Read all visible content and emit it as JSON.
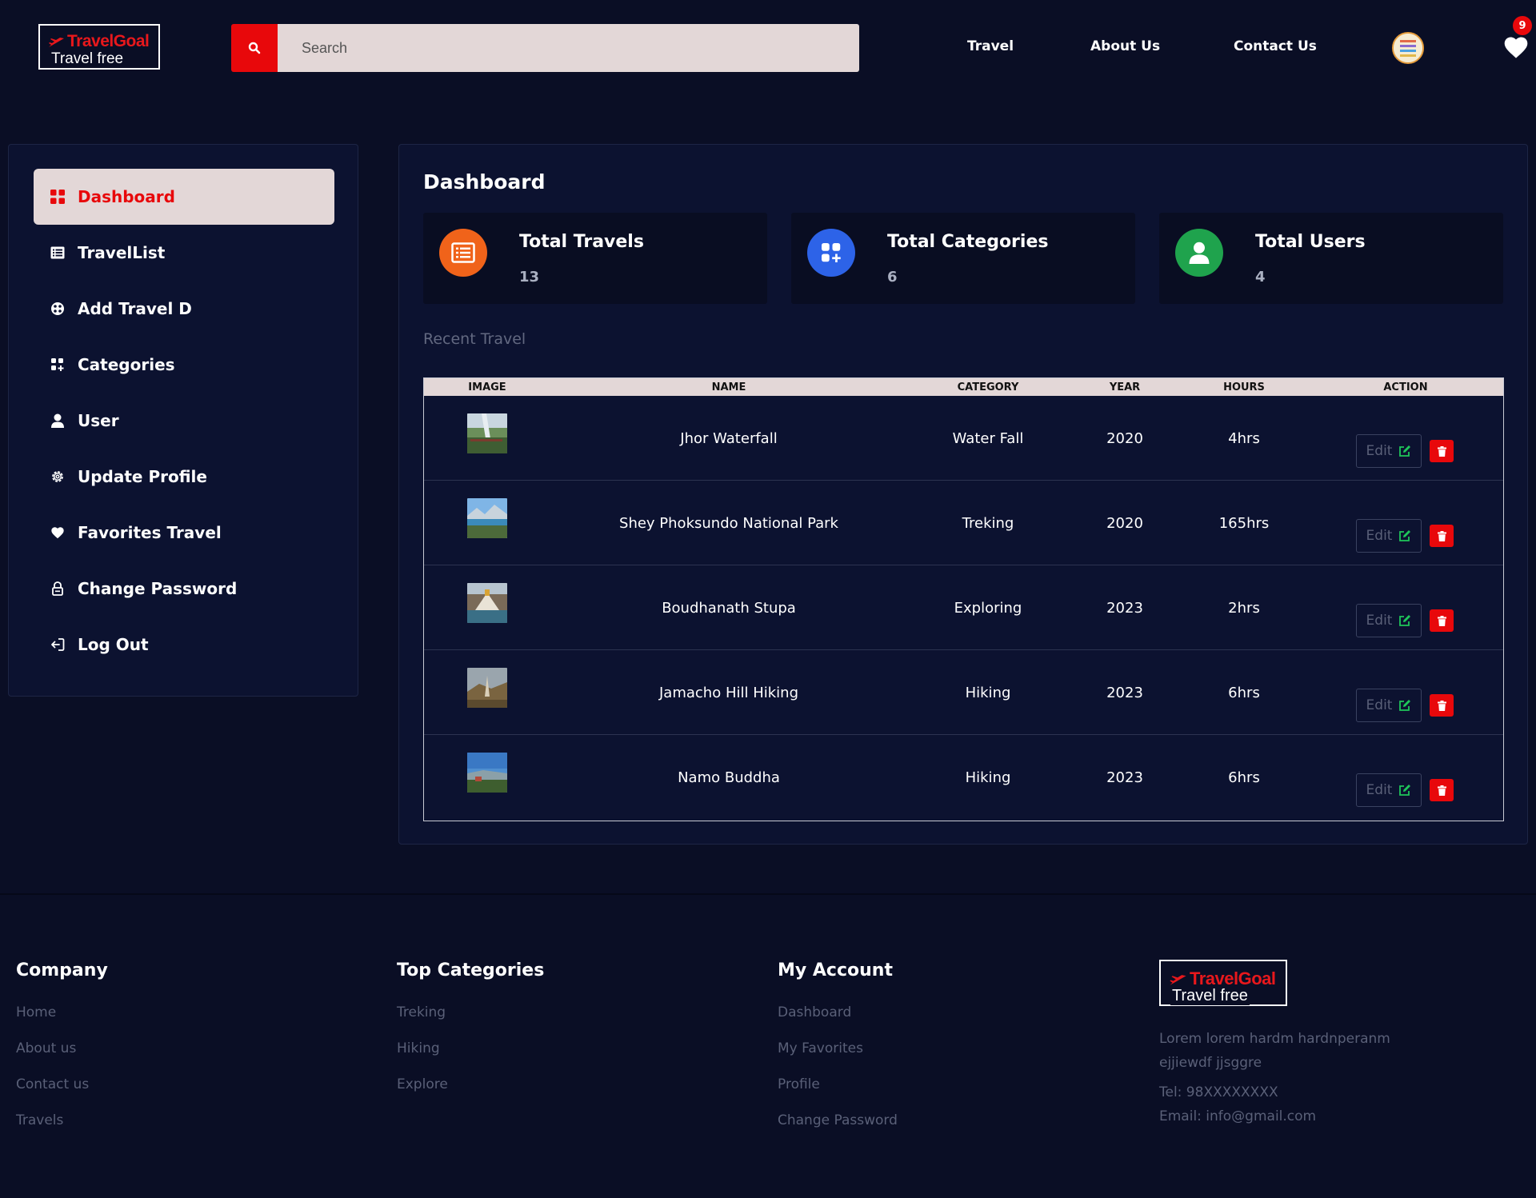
{
  "header": {
    "logo_brand": "TravelGoal",
    "logo_tagline": "Travel free",
    "search_placeholder": "Search",
    "nav": [
      "Travel",
      "About Us",
      "Contact Us"
    ],
    "favorites_count": "9"
  },
  "sidebar": {
    "items": [
      {
        "label": "Dashboard",
        "icon": "dashboard-grid-icon",
        "active": true
      },
      {
        "label": "TravelList",
        "icon": "list-icon"
      },
      {
        "label": "Add Travel D",
        "icon": "add-circle-icon"
      },
      {
        "label": "Categories",
        "icon": "categories-icon"
      },
      {
        "label": "User",
        "icon": "user-icon"
      },
      {
        "label": "Update Profile",
        "icon": "gear-icon"
      },
      {
        "label": "Favorites Travel",
        "icon": "heart-icon"
      },
      {
        "label": "Change Password",
        "icon": "lock-icon"
      },
      {
        "label": "Log Out",
        "icon": "logout-icon"
      }
    ]
  },
  "main": {
    "title": "Dashboard",
    "stats": [
      {
        "label": "Total Travels",
        "value": "13",
        "color": "#f0631a",
        "icon": "list-icon"
      },
      {
        "label": "Total Categories",
        "value": "6",
        "color": "#2d63e8",
        "icon": "categories-icon"
      },
      {
        "label": "Total Users",
        "value": "4",
        "color": "#1fa34d",
        "icon": "user-icon"
      }
    ],
    "section_label": "Recent Travel",
    "table": {
      "headers": [
        "IMAGE",
        "NAME",
        "CATEGORY",
        "YEAR",
        "HOURS",
        "ACTION"
      ],
      "edit_label": "Edit",
      "rows": [
        {
          "name": "Jhor Waterfall",
          "category": "Water Fall",
          "year": "2020",
          "hours": "4hrs"
        },
        {
          "name": "Shey Phoksundo National Park",
          "category": "Treking",
          "year": "2020",
          "hours": "165hrs"
        },
        {
          "name": "Boudhanath Stupa",
          "category": "Exploring",
          "year": "2023",
          "hours": "2hrs"
        },
        {
          "name": "Jamacho Hill Hiking",
          "category": "Hiking",
          "year": "2023",
          "hours": "6hrs"
        },
        {
          "name": "Namo Buddha",
          "category": "Hiking",
          "year": "2023",
          "hours": "6hrs"
        }
      ]
    }
  },
  "footer": {
    "company": {
      "title": "Company",
      "links": [
        "Home",
        "About us",
        "Contact us",
        "Travels"
      ]
    },
    "top_categories": {
      "title": "Top Categories",
      "links": [
        "Treking",
        "Hiking",
        "Explore"
      ]
    },
    "my_account": {
      "title": "My Account",
      "links": [
        "Dashboard",
        "My Favorites",
        "Profile",
        "Change Password"
      ]
    },
    "description": "Lorem lorem hardm hardnperanm ejjiewdf jjsggre",
    "tel": "Tel: 98XXXXXXXX",
    "email": "Email: info@gmail.com"
  },
  "colors": {
    "background": "#0a0e25",
    "panel": "#0c1230",
    "accent_red": "#e8080b",
    "active_bg": "#e3d7d7"
  }
}
